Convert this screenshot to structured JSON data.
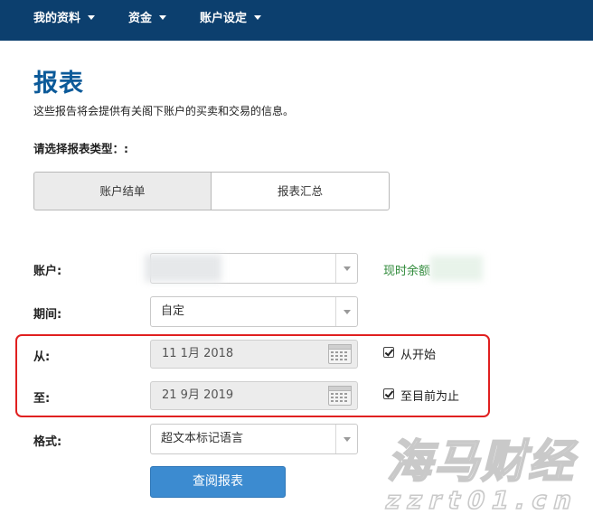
{
  "nav": {
    "items": [
      {
        "label": "我的资料"
      },
      {
        "label": "资金"
      },
      {
        "label": "账户设定"
      }
    ]
  },
  "page": {
    "title": "报表",
    "description": "这些报告将会提供有关阁下账户的买卖和交易的信息。",
    "select_prompt": "请选择报表类型：:"
  },
  "tabs": [
    {
      "label": "账户结单",
      "active": true
    },
    {
      "label": "报表汇总",
      "active": false
    }
  ],
  "form": {
    "account": {
      "label": "账户:",
      "value": ""
    },
    "balance_label": "现时余额",
    "period": {
      "label": "期间:",
      "value": "自定"
    },
    "from": {
      "label": "从:",
      "value": "11 1月 2018",
      "checkbox_label": "从开始",
      "checked": true
    },
    "to": {
      "label": "至:",
      "value": "21 9月 2019",
      "checkbox_label": "至目前为止",
      "checked": true
    },
    "format": {
      "label": "格式:",
      "value": "超文本标记语言"
    },
    "submit_label": "查阅报表"
  },
  "watermark": {
    "line1": "海马财经",
    "line2": "zzrt01.cn"
  },
  "colors": {
    "nav_bg": "#0c3f6e",
    "title": "#0c5a99",
    "button": "#3c8bd0",
    "balance": "#2f8a3a",
    "highlight": "#e02020"
  }
}
